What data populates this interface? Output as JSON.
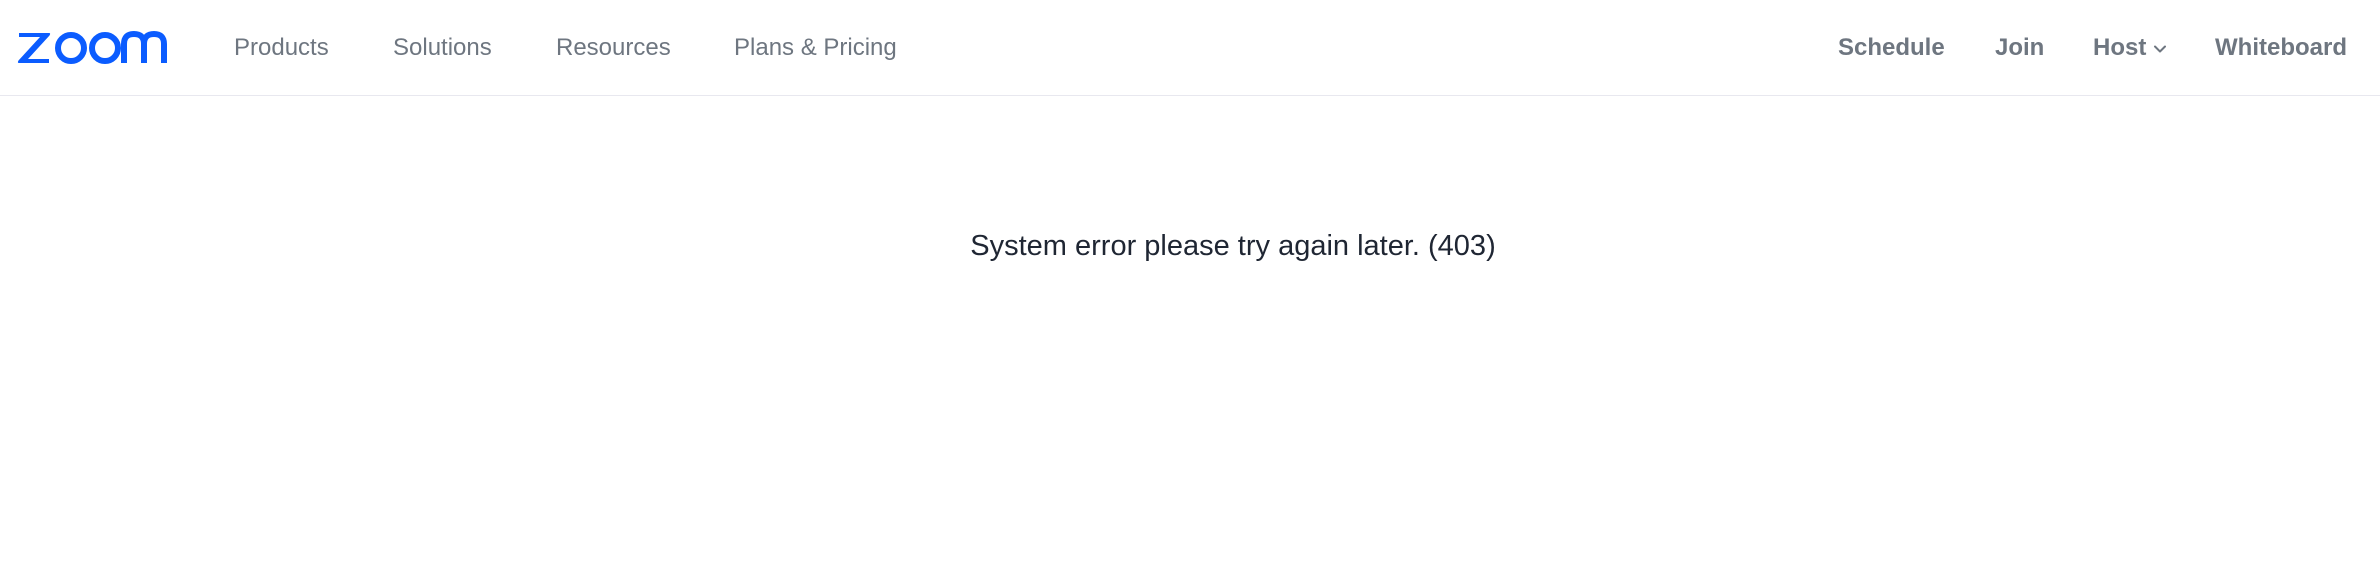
{
  "brand": {
    "name": "zoom",
    "color": "#0b5cff"
  },
  "nav": {
    "products": "Products",
    "solutions": "Solutions",
    "resources": "Resources",
    "plans_pricing": "Plans & Pricing",
    "schedule": "Schedule",
    "join": "Join",
    "host": "Host",
    "host_icon": "chevron-down",
    "whiteboard": "Whiteboard"
  },
  "main": {
    "error_message": "System error please try again later. (403)"
  },
  "colors": {
    "nav_text": "#6e7680",
    "body_text": "#1f2633",
    "divider": "#e8e8ef"
  }
}
